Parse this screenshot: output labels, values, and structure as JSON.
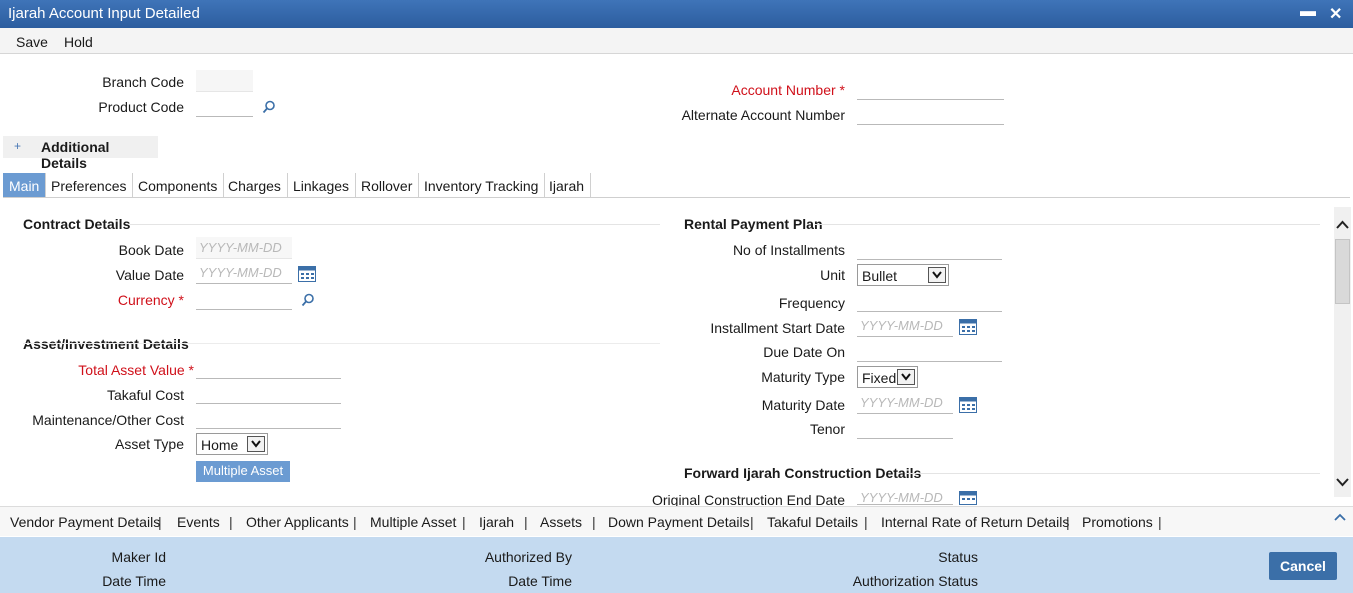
{
  "window": {
    "title": "Ijarah Account Input Detailed",
    "minimize": "▬",
    "close": "✕"
  },
  "menu": {
    "save": "Save",
    "hold": "Hold"
  },
  "header": {
    "branch_code": "Branch Code",
    "product_code": "Product Code",
    "account_number": "Account Number",
    "alternate_account_number": "Alternate Account Number",
    "required_mark": "*"
  },
  "additional_details": {
    "toggle": "+",
    "label": "Additional Details"
  },
  "tabs": [
    "Main",
    "Preferences",
    "Components",
    "Charges",
    "Linkages",
    "Rollover",
    "Inventory Tracking",
    "Ijarah"
  ],
  "contract_details": {
    "title": "Contract Details",
    "book_date": "Book Date",
    "value_date": "Value Date",
    "currency": "Currency",
    "date_placeholder": "YYYY-MM-DD"
  },
  "asset_details": {
    "title": "Asset/Investment Details",
    "total_asset_value": "Total Asset Value",
    "takaful_cost": "Takaful Cost",
    "maintenance_cost": "Maintenance/Other Cost",
    "asset_type": "Asset Type",
    "asset_type_value": "Home",
    "multiple_asset_button": "Multiple Asset"
  },
  "rental_plan": {
    "title": "Rental Payment Plan",
    "no_of_installments": "No of Installments",
    "unit": "Unit",
    "unit_value": "Bullet",
    "frequency": "Frequency",
    "installment_start_date": "Installment Start Date",
    "due_date_on": "Due Date On",
    "maturity_type": "Maturity Type",
    "maturity_type_value": "Fixed",
    "maturity_date": "Maturity Date",
    "tenor": "Tenor"
  },
  "construction": {
    "title": "Forward Ijarah Construction Details",
    "original_end_date": "Original Construction End Date"
  },
  "links": [
    "Vendor Payment Details",
    "Events",
    "Other Applicants",
    "Multiple Asset",
    "Ijarah",
    "Assets",
    "Down Payment Details",
    "Takaful Details",
    "Internal Rate of Return Details",
    "Promotions"
  ],
  "link_separator": "|",
  "footer": {
    "maker_id": "Maker Id",
    "date_time_1": "Date Time",
    "authorized_by": "Authorized By",
    "date_time_2": "Date Time",
    "status": "Status",
    "authorization_status": "Authorization Status",
    "cancel": "Cancel"
  },
  "colors": {
    "accent": "#6b9bd2",
    "titlebar": "#2c5d9f",
    "required": "#d0101a",
    "footer": "#c4daf0"
  }
}
